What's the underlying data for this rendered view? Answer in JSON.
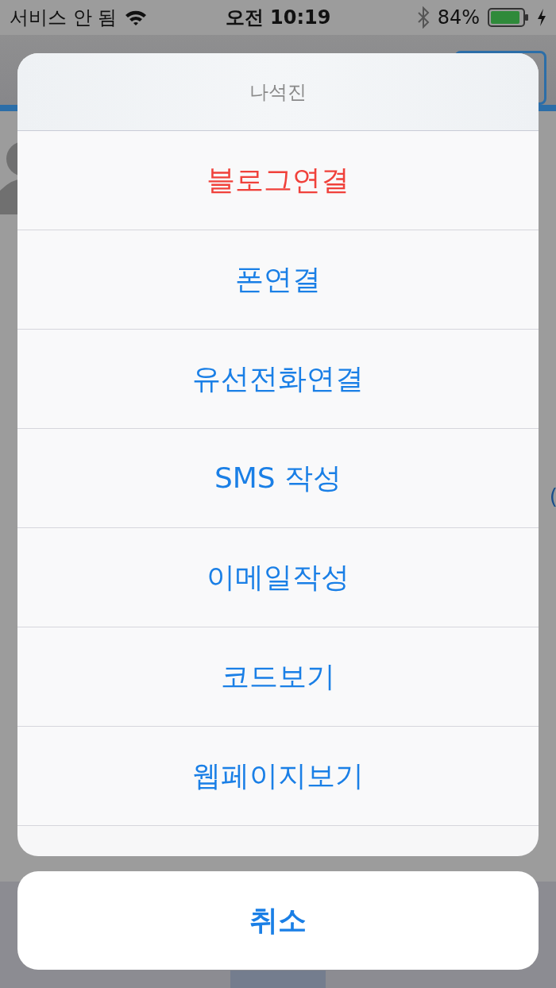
{
  "status_bar": {
    "carrier": "서비스 안 됨",
    "time": "오전 10:19",
    "battery": "84%"
  },
  "background": {
    "fragment": "("
  },
  "action_sheet": {
    "title": "나석진",
    "actions": [
      {
        "label": "블로그연결",
        "kind": "destructive"
      },
      {
        "label": "폰연결",
        "kind": "default"
      },
      {
        "label": "유선전화연결",
        "kind": "default"
      },
      {
        "label": "SMS 작성",
        "kind": "default"
      },
      {
        "label": "이메일작성",
        "kind": "default"
      },
      {
        "label": "코드보기",
        "kind": "default"
      },
      {
        "label": "웹페이지보기",
        "kind": "default"
      }
    ],
    "cancel": "취소"
  }
}
